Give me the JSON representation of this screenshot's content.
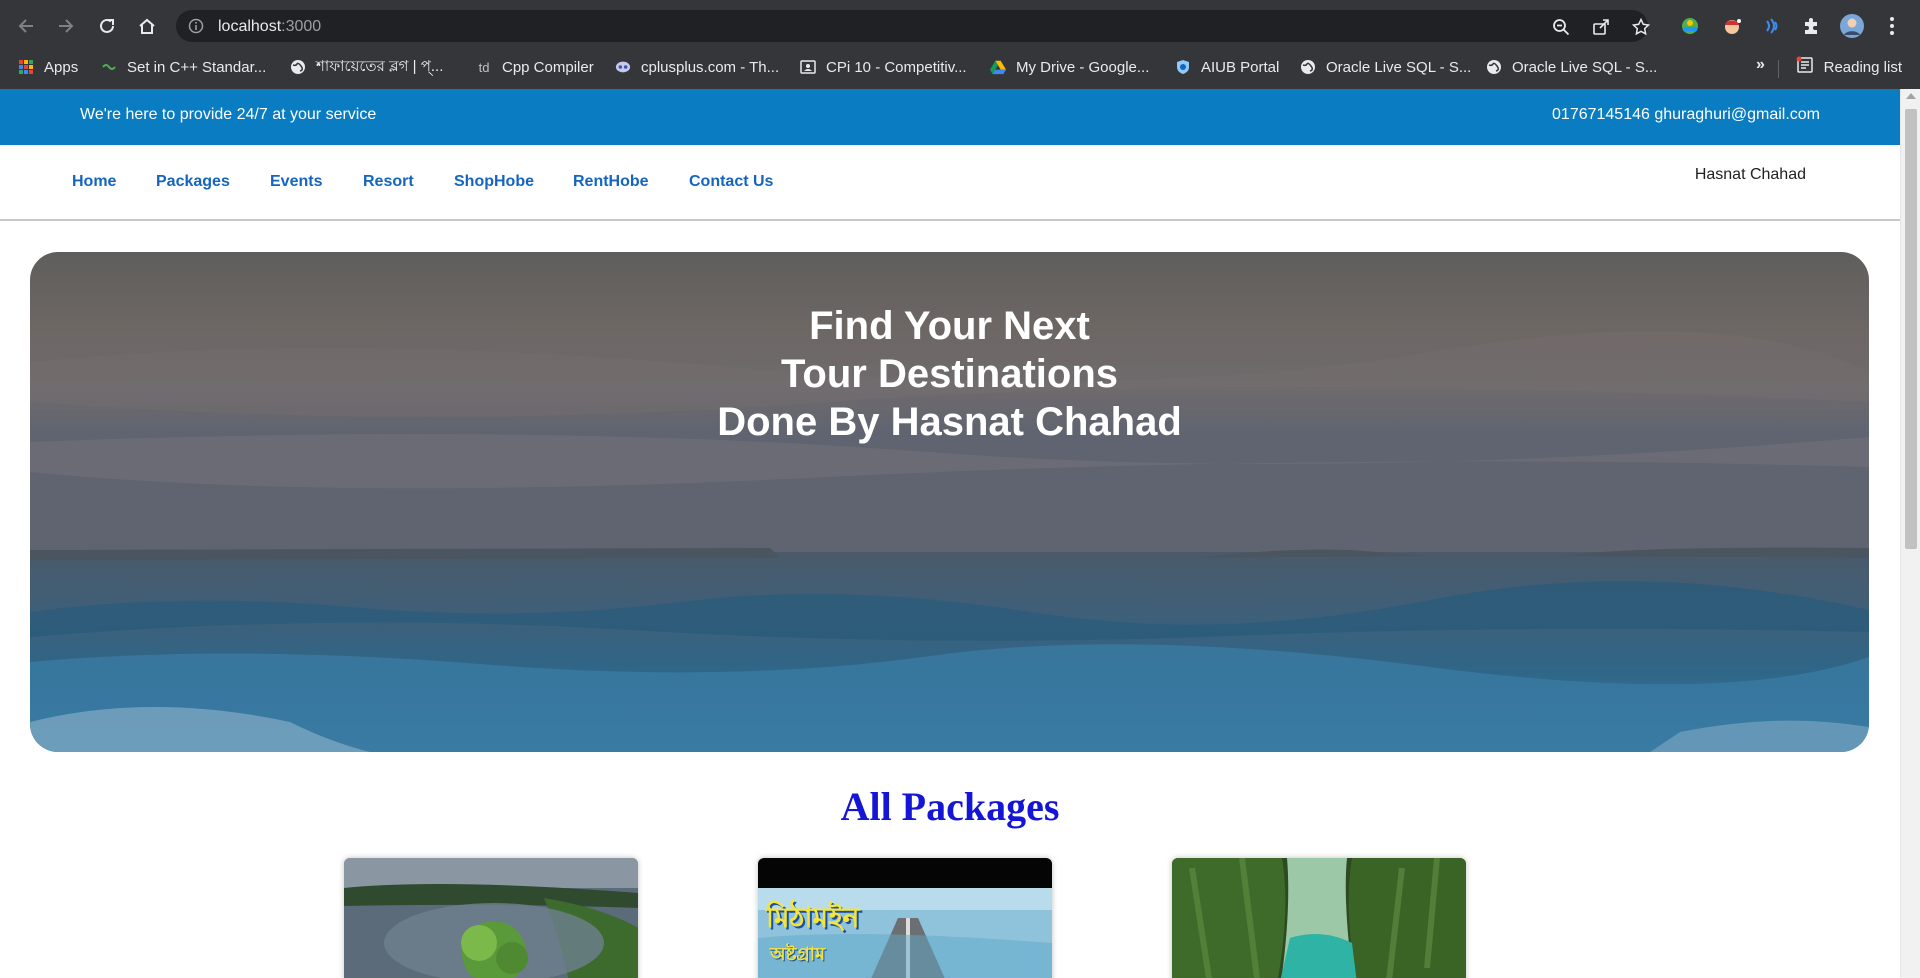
{
  "browser": {
    "url_host": "localhost",
    "url_port": ":3000",
    "bookmarks": [
      {
        "label": "Apps",
        "icon": "apps-grid-icon"
      },
      {
        "label": "Set in C++ Standar...",
        "icon": "cpp-icon"
      },
      {
        "label": "শাফায়েতের ব্লগ | প্...",
        "icon": "globe-icon"
      },
      {
        "label": "Cpp Compiler",
        "icon": "td-icon"
      },
      {
        "label": "cplusplus.com - Th...",
        "icon": "cplusplus-icon"
      },
      {
        "label": "CPi 10 - Competitiv...",
        "icon": "cpi-icon"
      },
      {
        "label": "My Drive - Google...",
        "icon": "google-drive-icon"
      },
      {
        "label": "AIUB Portal",
        "icon": "aiub-icon"
      },
      {
        "label": "Oracle Live SQL - S...",
        "icon": "globe-icon"
      },
      {
        "label": "Oracle Live SQL - S...",
        "icon": "globe-icon"
      }
    ],
    "overflow": "»",
    "reading_list": "Reading list"
  },
  "topbar": {
    "tagline": "We're here to provide 24/7 at your service",
    "contact": "01767145146 ghuraghuri@gmail.com"
  },
  "nav": {
    "links": [
      "Home",
      "Packages",
      "Events",
      "Resort",
      "ShopHobe",
      "RentHobe",
      "Contact Us"
    ],
    "user": "Hasnat Chahad"
  },
  "hero": {
    "line1": "Find Your Next",
    "line2": "Tour Destinations",
    "line3": "Done By Hasnat Chahad"
  },
  "packages": {
    "title": "All Packages",
    "cards": [
      {
        "image": "lake-island-aerial-photo"
      },
      {
        "image": "mithamoin-road-photo",
        "overlay_main": "মিঠামইন",
        "overlay_sub": "অষ্টগ্রাম"
      },
      {
        "image": "green-canyon-river-photo"
      }
    ]
  },
  "colors": {
    "topbar": "#0a7cc2",
    "nav_link": "#1565c0",
    "section_title": "#1515d6",
    "chrome": "#35363a"
  }
}
